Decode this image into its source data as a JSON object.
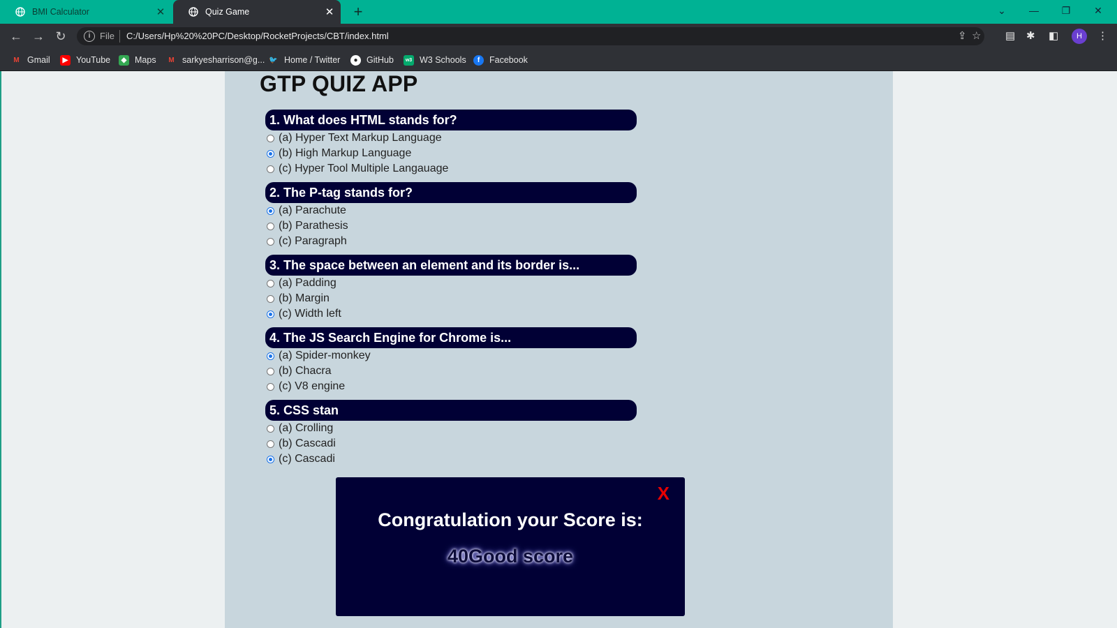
{
  "browser": {
    "tabs": [
      {
        "title": "BMI Calculator",
        "active": false
      },
      {
        "title": "Quiz Game",
        "active": true
      }
    ],
    "new_tab_label": "+",
    "omnibox": {
      "scheme_label": "File",
      "url": "C:/Users/Hp%20%20PC/Desktop/RocketProjects/CBT/index.html"
    },
    "profile_initial": "H",
    "bookmarks": [
      {
        "label": "Gmail",
        "icon": "gmail-icon",
        "color": "#ea4335"
      },
      {
        "label": "YouTube",
        "icon": "youtube-icon",
        "color": "#ff0000"
      },
      {
        "label": "Maps",
        "icon": "maps-icon",
        "color": "#34a853"
      },
      {
        "label": "sarkyesharrison@g...",
        "icon": "gmail-icon",
        "color": "#ea4335"
      },
      {
        "label": "Home / Twitter",
        "icon": "twitter-icon",
        "color": "#1d9bf0"
      },
      {
        "label": "GitHub",
        "icon": "github-icon",
        "color": "#ffffff"
      },
      {
        "label": "W3 Schools",
        "icon": "w3schools-icon",
        "color": "#04aa6d"
      },
      {
        "label": "Facebook",
        "icon": "facebook-icon",
        "color": "#1877f2"
      }
    ]
  },
  "app": {
    "title": "GTP QUIZ APP",
    "questions": [
      {
        "text": "1. What does HTML stands for?",
        "options": [
          "(a) Hyper Text Markup Language",
          "(b) High Markup Language",
          "(c) Hyper Tool Multiple Langauage"
        ],
        "selected": 1
      },
      {
        "text": "2. The P-tag stands for?",
        "options": [
          "(a) Parachute",
          "(b) Parathesis",
          "(c) Paragraph"
        ],
        "selected": 0
      },
      {
        "text": "3. The space between an element and its border is...",
        "options": [
          "(a) Padding",
          "(b) Margin",
          "(c) Width left"
        ],
        "selected": 2
      },
      {
        "text": "4. The JS Search Engine for Chrome is...",
        "options": [
          "(a) Spider-monkey",
          "(b) Chacra",
          "(c) V8 engine"
        ],
        "selected": 0
      },
      {
        "text": "5. CSS stan",
        "options": [
          "(a) Crolling",
          "(b) Cascadi",
          "(c) Cascadi"
        ],
        "selected": 2
      }
    ]
  },
  "modal": {
    "close_label": "X",
    "title": "Congratulation your Score is:",
    "score_text": "40Good score"
  },
  "colors": {
    "tabbar": "#00b294",
    "chrome_dark": "#2f3136",
    "question_header": "#010035",
    "container_bg": "#c8d6dd",
    "close_red": "#e60000"
  }
}
